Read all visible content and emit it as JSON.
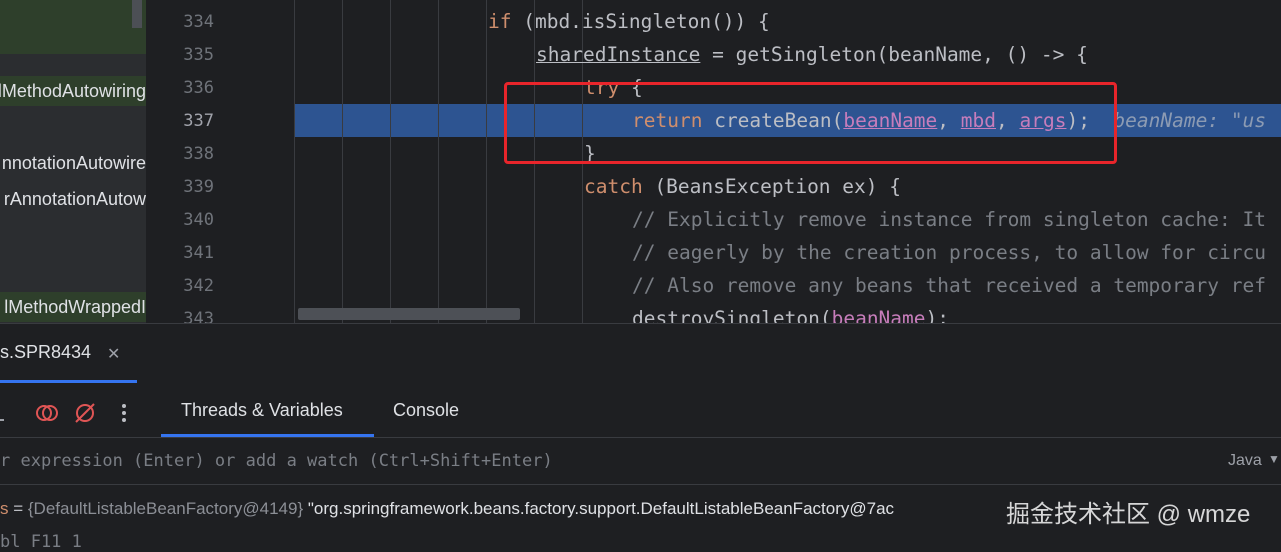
{
  "tree": {
    "items": [
      "lMethodAutowiring",
      "nnotationAutowire",
      "rAnnotationAutow",
      "lMethodWrappedI"
    ]
  },
  "editor": {
    "line_numbers": [
      "334",
      "335",
      "336",
      "337",
      "338",
      "339",
      "340",
      "341",
      "342",
      "343"
    ],
    "lines": {
      "l334": {
        "kw": "if",
        "rest": " (mbd.isSingleton()) {"
      },
      "l335": {
        "var": "sharedInstance",
        "mid": " = ",
        "fn": "getSingleton",
        "rest": "(beanName, () -> {"
      },
      "l336": {
        "kw": "try",
        "rest": " {"
      },
      "l337": {
        "kw": "return",
        "fn": "createBean",
        "p1": "beanName",
        "p2": "mbd",
        "p3": "args",
        "hint": "beanName: \"us"
      },
      "l338": {
        "rest": "}"
      },
      "l339": {
        "kw": "catch",
        "rest": " (BeansException ex) {"
      },
      "l340": {
        "comment": "// Explicitly remove instance from singleton cache: It"
      },
      "l341": {
        "comment": "// eagerly by the creation process, to allow for circu"
      },
      "l342": {
        "comment": "// Also remove any beans that received a temporary ref"
      },
      "l343": {
        "fn": "destroySingleton",
        "p1": "beanName",
        "rest": ");"
      }
    }
  },
  "debug": {
    "session_tab": "s.SPR8434",
    "tabs": {
      "threads": "Threads & Variables",
      "console": "Console"
    },
    "watch_placeholder": "r expression (Enter) or add a watch (Ctrl+Shift+Enter)",
    "language": "Java",
    "variable": {
      "name": "s",
      "eq": " = ",
      "type": "{DefaultListableBeanFactory@4149}",
      "value": " \"org.springframework.beans.factory.support.DefaultListableBeanFactory@7ac"
    },
    "watermark": "掘金技术社区 @ wmze",
    "next_row": "bl                F11   1"
  },
  "colors": {
    "exec_line": "#2d5491",
    "highlight_box": "#e8252b",
    "accent": "#3574f0"
  }
}
